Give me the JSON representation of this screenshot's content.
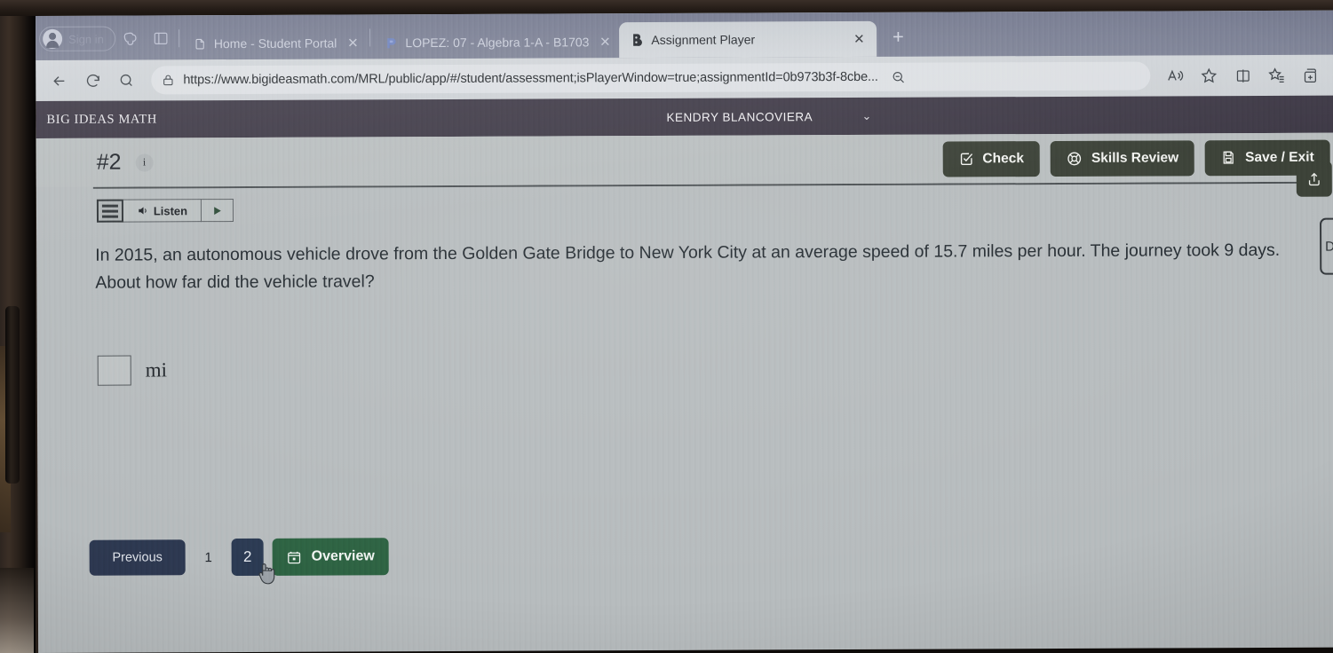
{
  "browser": {
    "profile": {
      "label": "Sign in",
      "icon": "account-avatar-icon"
    },
    "chrome_icons": [
      {
        "name": "copilot-icon"
      },
      {
        "name": "tab-layout-icon"
      }
    ],
    "tabs": [
      {
        "title": "Home - Student Portal",
        "favicon": "page-icon",
        "active": false,
        "close": "✕"
      },
      {
        "title": "LOPEZ: 07 - Algebra 1-A - B1703",
        "favicon": "powerschool-icon",
        "active": false,
        "close": "✕"
      },
      {
        "title": "Assignment Player",
        "favicon": "bigideas-b-icon",
        "active": true,
        "close": "✕"
      }
    ],
    "new_tab": "+",
    "nav": {
      "back": "back-arrow-icon",
      "refresh": "refresh-icon",
      "search": "search-icon"
    },
    "omnibox": {
      "lock": "lock-icon",
      "url": "https://www.bigideasmath.com/MRL/public/app/#/student/assessment;isPlayerWindow=true;assignmentId=0b973b3f-8cbe...",
      "zoom_out": "zoom-out-icon"
    },
    "toolbar_icons": [
      {
        "name": "read-aloud-icon"
      },
      {
        "name": "favorite-star-icon"
      },
      {
        "name": "split-screen-icon"
      },
      {
        "name": "collections-icon"
      },
      {
        "name": "add-to-collections-icon"
      }
    ]
  },
  "app": {
    "logo": "BIG IDEAS MATH",
    "user": "KENDRY BLANCOVIERA",
    "user_caret": "⌄"
  },
  "question_toolbar": {
    "number": "#2",
    "info": "i",
    "buttons": [
      {
        "label": "Check",
        "icon": "check-square-icon",
        "color": "#3a4036"
      },
      {
        "label": "Skills Review",
        "icon": "life-ring-icon",
        "color": "#3a4036"
      },
      {
        "label": "Save / Exit",
        "icon": "floppy-save-icon",
        "color": "#3a4036"
      }
    ],
    "share_button": {
      "icon": "share-upload-icon",
      "color": "#3a4036"
    }
  },
  "listen_bar": {
    "menu_icon": "list-menu-icon",
    "label": "Listen",
    "speaker_icon": "speaker-icon",
    "play_icon": "play-triangle-icon"
  },
  "question": {
    "text": "In 2015, an autonomous vehicle drove from the Golden Gate Bridge to New York City at an average speed of 15.7 miles per hour. The journey took 9 days. About how far did the vehicle travel?",
    "answer_value": "",
    "answer_placeholder": "",
    "unit": "mi"
  },
  "bottom_nav": {
    "previous": "Previous",
    "page_1": "1",
    "page_2": "2",
    "overview": "Overview",
    "overview_icon": "calendar-grid-icon",
    "cursor": "hand-pointer-cursor"
  },
  "right_edge": {
    "clipped_label": "D"
  },
  "colors": {
    "app_header": "#3d3845",
    "content_bg": "#b8bdbe",
    "button_olive": "#3a4036",
    "button_navy": "#2d3850",
    "button_page_active": "#2b3a52",
    "button_green": "#2d6242"
  }
}
